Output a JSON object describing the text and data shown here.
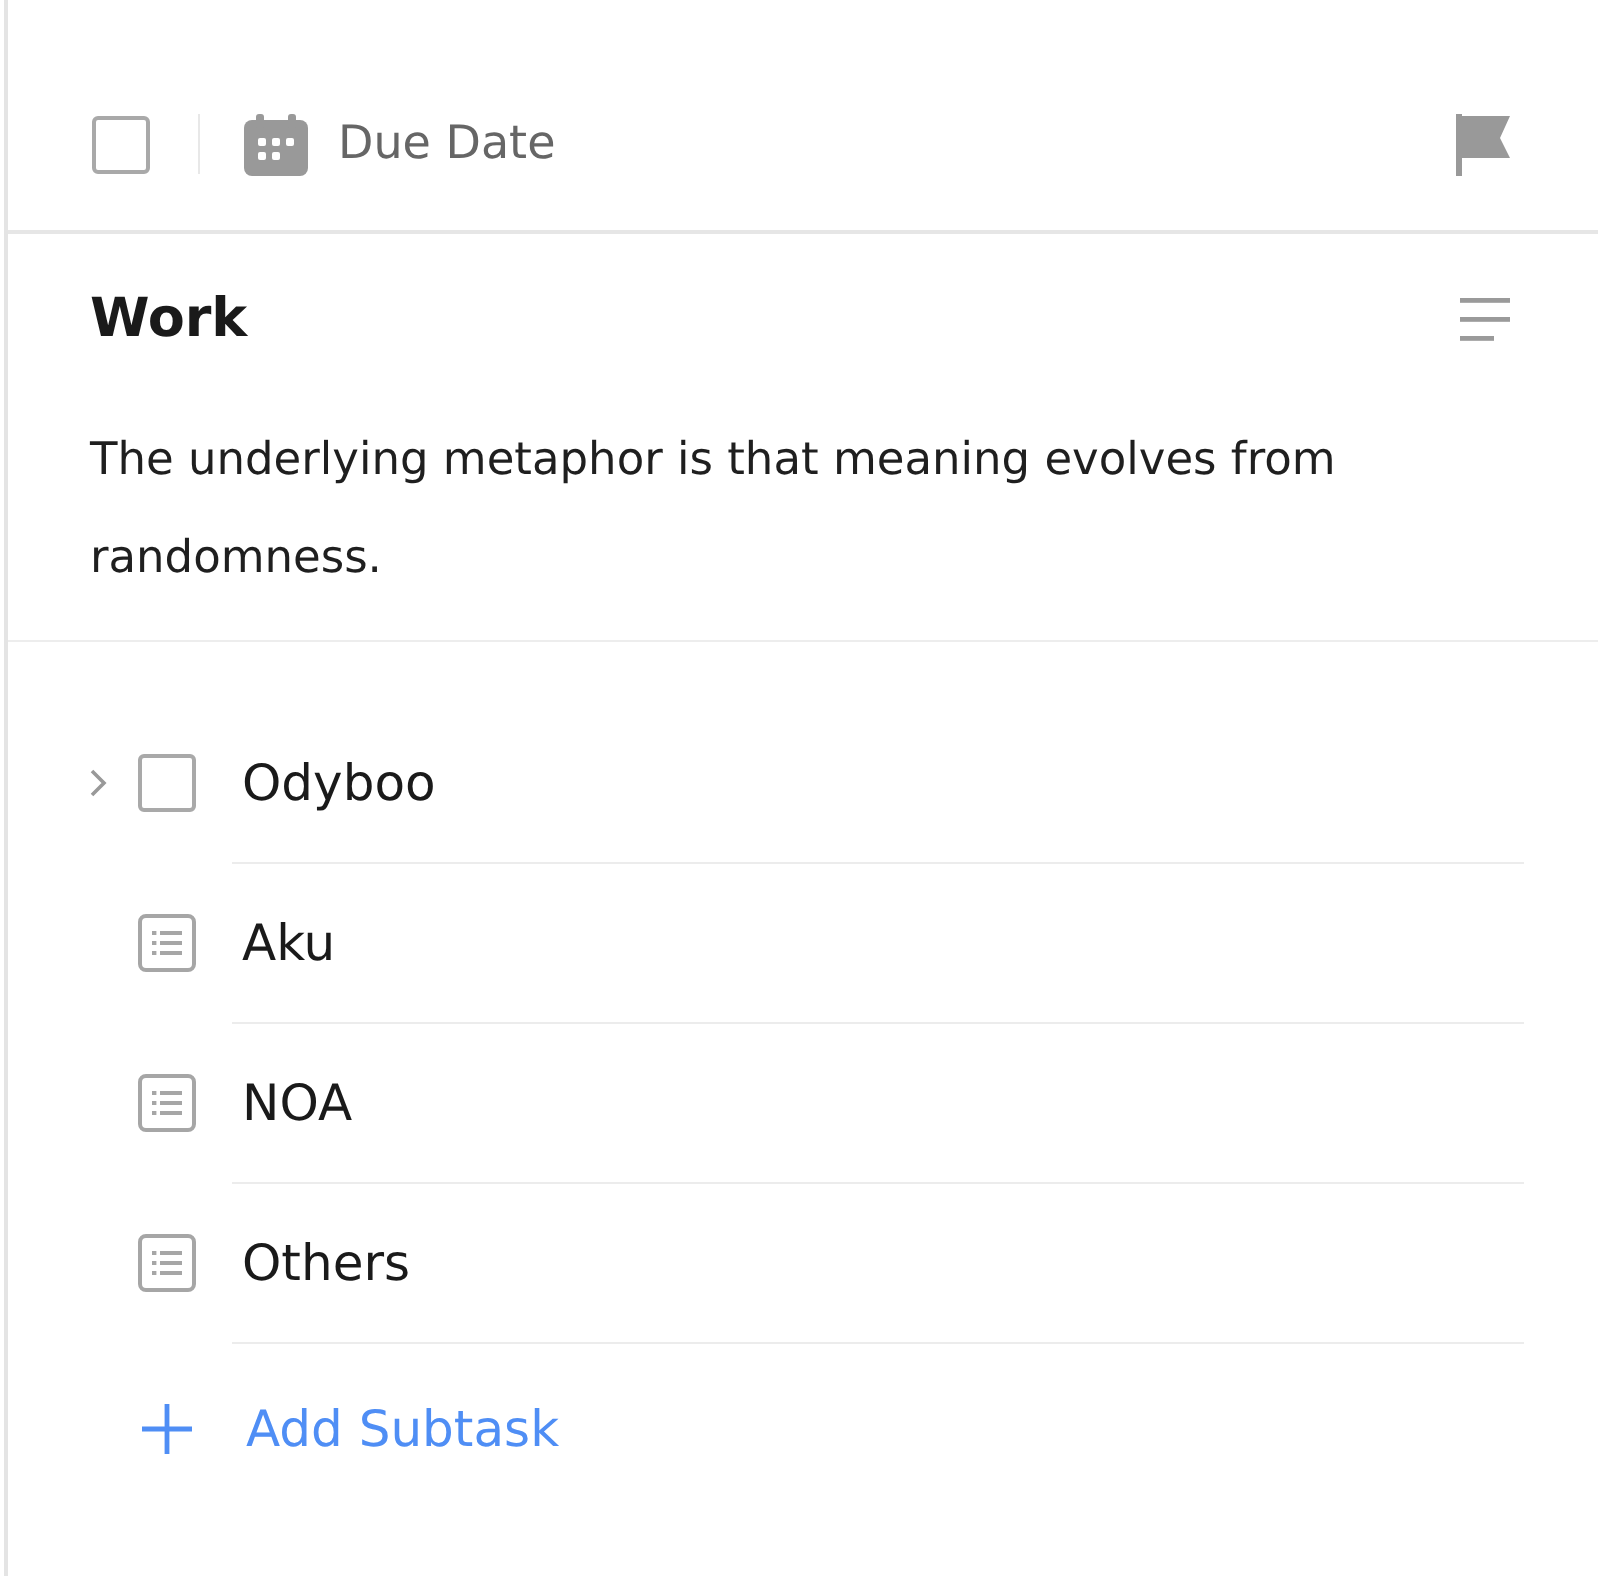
{
  "toolbar": {
    "checked": false,
    "due_date": "Due Date"
  },
  "task": {
    "title": "Work",
    "description": "The underlying metaphor is that meaning evolves from randomness."
  },
  "subtasks": [
    {
      "kind": "task",
      "title": "Odyboo",
      "checked": false,
      "expanded": false
    },
    {
      "kind": "note",
      "title": "Aku"
    },
    {
      "kind": "note",
      "title": "NOA"
    },
    {
      "kind": "note",
      "title": "Others"
    }
  ],
  "add_subtask": {
    "label": "Add Subtask"
  }
}
